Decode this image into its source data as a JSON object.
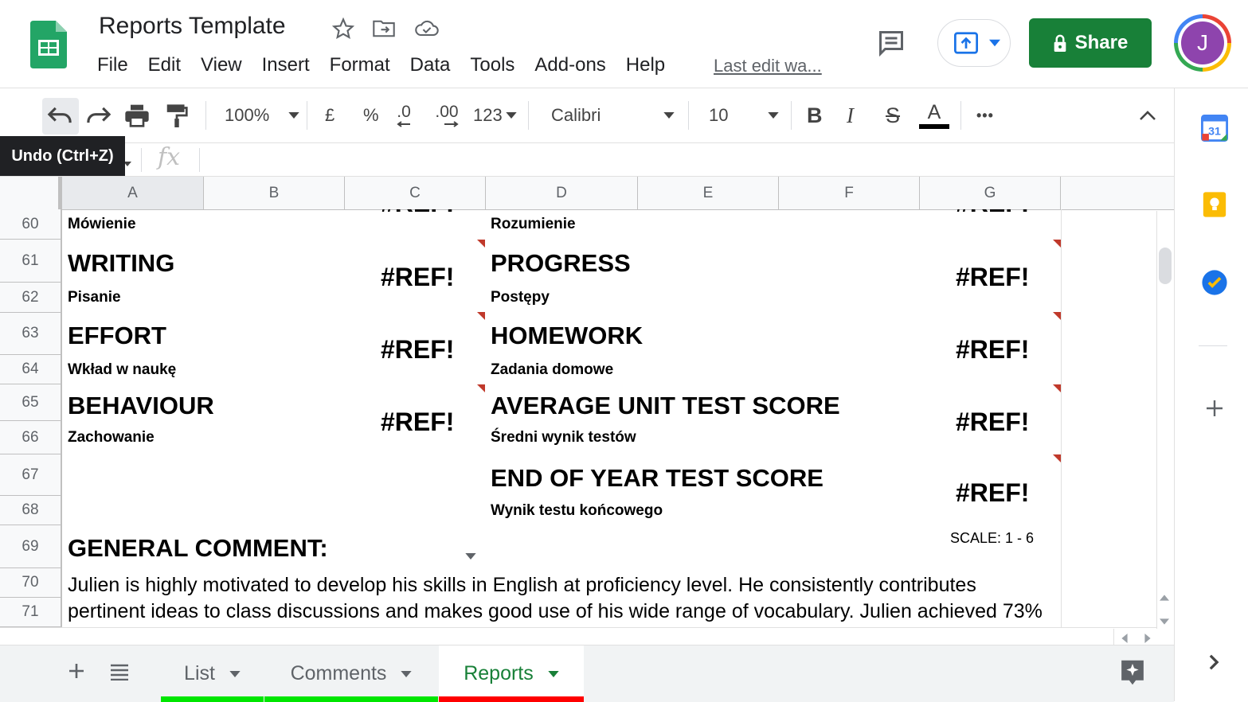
{
  "doc": {
    "title": "Reports Template",
    "last_edit": "Last edit wa..."
  },
  "menu": [
    "File",
    "Edit",
    "View",
    "Insert",
    "Format",
    "Data",
    "Tools",
    "Add-ons",
    "Help"
  ],
  "share": {
    "label": "Share"
  },
  "avatar": {
    "initial": "J"
  },
  "toolbar": {
    "zoom": "100%",
    "currency": "£",
    "percent": "%",
    "dec_decrease": ".0",
    "dec_increase": ".00",
    "format_more": "123",
    "font": "Calibri",
    "font_size": "10",
    "bold": "B",
    "italic": "I",
    "strike": "S",
    "text_color": "A",
    "more": "•••"
  },
  "tooltip": "Undo (Ctrl+Z)",
  "formula_bar": {
    "fx": "fx"
  },
  "columns": [
    "A",
    "B",
    "C",
    "D",
    "E",
    "F",
    "G"
  ],
  "rows": [
    "60",
    "61",
    "62",
    "63",
    "64",
    "65",
    "66",
    "67",
    "68",
    "69",
    "70",
    "71"
  ],
  "cells": {
    "partial_top_c": "#REF!",
    "partial_top_g": "#REF!",
    "a60": "Mówienie",
    "d60": "Rozumienie",
    "a61": "WRITING",
    "d61": "PROGRESS",
    "c61": "#REF!",
    "g61": "#REF!",
    "a62": "Pisanie",
    "d62": "Postępy",
    "a63": "EFFORT",
    "d63": "HOMEWORK",
    "c63": "#REF!",
    "g63": "#REF!",
    "a64": "Wkład w naukę",
    "d64": "Zadania domowe",
    "a65": "BEHAVIOUR",
    "d65": "AVERAGE UNIT TEST SCORE",
    "c65": "#REF!",
    "g65": "#REF!",
    "a66": "Zachowanie",
    "d66": "Średni wynik testów",
    "d67": "END OF YEAR TEST SCORE",
    "g67": "#REF!",
    "d68": "Wynik testu końcowego",
    "a69": "GENERAL COMMENT:",
    "g69": "SCALE: 1 - 6",
    "a70": "Julien is highly motivated to develop his skills in English at proficiency level.  He consistently contributes",
    "a71": "pertinent ideas to class discussions and makes good use of his wide range of vocabulary. Julien achieved 73%"
  },
  "tabs": [
    {
      "label": "List",
      "color": "#00e600"
    },
    {
      "label": "Comments",
      "color": "#00e600"
    },
    {
      "label": "Reports",
      "color": "#ff0000"
    }
  ],
  "colors": {
    "share_green": "#188038",
    "active_tab_text": "#188038"
  }
}
